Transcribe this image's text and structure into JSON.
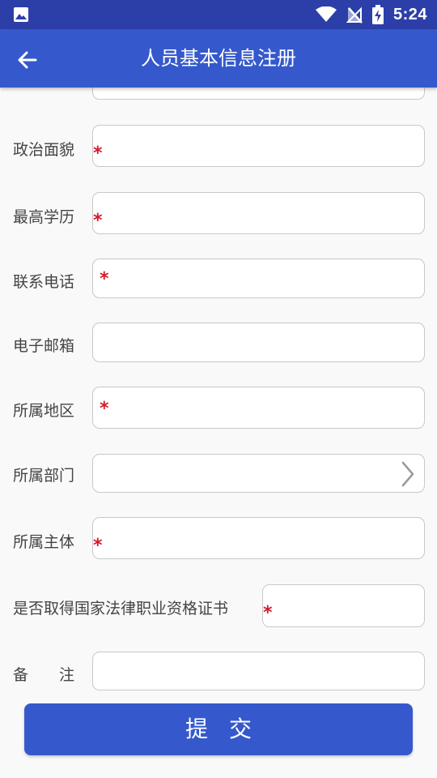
{
  "status_bar": {
    "time": "5:24",
    "icons": [
      "image-icon",
      "wifi-icon",
      "no-sim-icon",
      "battery-charging-icon"
    ]
  },
  "app_bar": {
    "title": "人员基本信息注册",
    "back_icon": "arrow-left-icon"
  },
  "form": {
    "required_mark": "*",
    "fields": [
      {
        "label": "政治面貌",
        "required": true
      },
      {
        "label": "最高学历",
        "required": true
      },
      {
        "label": "联系电话",
        "required": true
      },
      {
        "label": "电子邮箱",
        "required": false
      },
      {
        "label": "所属地区",
        "required": true
      },
      {
        "label": "所属部门",
        "required": false,
        "type": "select",
        "icon": "chevron-right-icon"
      },
      {
        "label": "所属主体",
        "required": true
      },
      {
        "label": "是否取得国家法律职业资格证书",
        "required": true
      },
      {
        "label": "备　　注",
        "required": false
      }
    ]
  },
  "submit_button": {
    "label": "提交"
  },
  "colors": {
    "status_bar": "#2c3fa9",
    "app_bar": "#3559cc",
    "required": "#d8182a",
    "button": "#3559cc"
  }
}
